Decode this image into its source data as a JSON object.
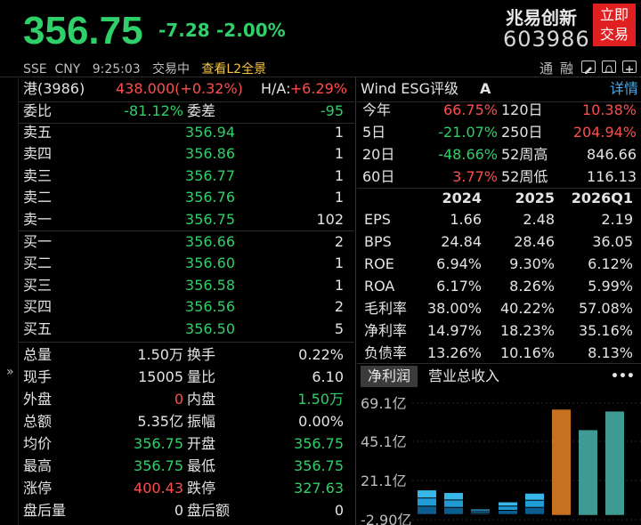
{
  "header": {
    "price": "356.75",
    "change": "-7.28",
    "change_pct": "-2.00%",
    "exchange": "SSE",
    "currency": "CNY",
    "time": "9:25:03",
    "status": "交易中",
    "l2_link": "查看L2全景",
    "stock_name": "兆易创新",
    "stock_code": "603986",
    "trade_button": [
      "立即",
      "交易"
    ],
    "tools": [
      "通",
      "融"
    ]
  },
  "hk_line": {
    "label": "港(3986)",
    "value": "438.000(+0.32%)",
    "ha_label": "H/A:",
    "ha_value": "+6.29%"
  },
  "order_ratio": {
    "ratio_label": "委比",
    "ratio_value": "-81.12%",
    "diff_label": "委差",
    "diff_value": "-95"
  },
  "asks": [
    {
      "label": "卖五",
      "price": "356.94",
      "vol": "1"
    },
    {
      "label": "卖四",
      "price": "356.86",
      "vol": "1"
    },
    {
      "label": "卖三",
      "price": "356.77",
      "vol": "1"
    },
    {
      "label": "卖二",
      "price": "356.76",
      "vol": "1"
    },
    {
      "label": "卖一",
      "price": "356.75",
      "vol": "102"
    }
  ],
  "bids": [
    {
      "label": "买一",
      "price": "356.66",
      "vol": "2"
    },
    {
      "label": "买二",
      "price": "356.60",
      "vol": "1"
    },
    {
      "label": "买三",
      "price": "356.58",
      "vol": "1"
    },
    {
      "label": "买四",
      "price": "356.56",
      "vol": "2"
    },
    {
      "label": "买五",
      "price": "356.50",
      "vol": "5"
    }
  ],
  "stats": [
    {
      "l1": "总量",
      "v1": "1.50万",
      "c1": "w",
      "l2": "换手",
      "v2": "0.22%",
      "c2": "w"
    },
    {
      "l1": "现手",
      "v1": "15005",
      "c1": "w",
      "l2": "量比",
      "v2": "6.10",
      "c2": "w"
    },
    {
      "l1": "外盘",
      "v1": "0",
      "c1": "r",
      "l2": "内盘",
      "v2": "1.50万",
      "c2": "g"
    },
    {
      "l1": "总额",
      "v1": "5.35亿",
      "c1": "w",
      "l2": "振幅",
      "v2": "0.00%",
      "c2": "w"
    },
    {
      "l1": "均价",
      "v1": "356.75",
      "c1": "g",
      "l2": "开盘",
      "v2": "356.75",
      "c2": "g"
    },
    {
      "l1": "最高",
      "v1": "356.75",
      "c1": "g",
      "l2": "最低",
      "v2": "356.75",
      "c2": "g"
    },
    {
      "l1": "涨停",
      "v1": "400.43",
      "c1": "r",
      "l2": "跌停",
      "v2": "327.63",
      "c2": "g"
    },
    {
      "l1": "盘后量",
      "v1": "0",
      "c1": "w",
      "l2": "盘后额",
      "v2": "0",
      "c2": "w"
    }
  ],
  "side_toggle": "»",
  "esg": {
    "title": "Wind ESG评级",
    "rating": "A",
    "detail_link": "详情"
  },
  "performance": [
    {
      "l1": "今年",
      "v1": "66.75%",
      "c1": "r",
      "l2": "120日",
      "v2": "10.38%",
      "c2": "r"
    },
    {
      "l1": "5日",
      "v1": "-21.07%",
      "c1": "g",
      "l2": "250日",
      "v2": "204.94%",
      "c2": "r"
    },
    {
      "l1": "20日",
      "v1": "-48.66%",
      "c1": "g",
      "l2": "52周高",
      "v2": "846.66",
      "c2": "w"
    },
    {
      "l1": "60日",
      "v1": "3.77%",
      "c1": "r",
      "l2": "52周低",
      "v2": "116.13",
      "c2": "w"
    }
  ],
  "financials": {
    "years": [
      "2024",
      "2025",
      "2026Q1"
    ],
    "rows": [
      {
        "label": "EPS",
        "values": [
          "1.66",
          "2.48",
          "2.19"
        ]
      },
      {
        "label": "BPS",
        "values": [
          "24.84",
          "28.46",
          "36.05"
        ]
      },
      {
        "label": "ROE",
        "values": [
          "6.94%",
          "9.30%",
          "6.12%"
        ]
      },
      {
        "label": "ROA",
        "values": [
          "6.17%",
          "8.26%",
          "5.99%"
        ]
      },
      {
        "label": "毛利率",
        "values": [
          "38.00%",
          "40.22%",
          "57.08%"
        ]
      },
      {
        "label": "净利率",
        "values": [
          "14.97%",
          "18.23%",
          "35.16%"
        ]
      },
      {
        "label": "负债率",
        "values": [
          "13.26%",
          "10.16%",
          "8.13%"
        ]
      }
    ]
  },
  "chart_tabs": [
    "净利润",
    "营业总收入"
  ],
  "more_label": "•••",
  "chart_data": {
    "type": "bar",
    "y_ticks": [
      "69.1亿",
      "45.1亿",
      "21.1亿",
      "-2.90亿"
    ],
    "ylim": [
      -2.9,
      69.1
    ],
    "bars": [
      {
        "value": 15.2,
        "color": "#1f9bd6",
        "stack": [
          5.2,
          5.0,
          5.0
        ]
      },
      {
        "value": 13.6,
        "color": "#1f9bd6",
        "stack": [
          4.4,
          4.6,
          4.6
        ]
      },
      {
        "value": 3.4,
        "color": "#1f9bd6",
        "stack": [
          1.1,
          1.1,
          1.2
        ]
      },
      {
        "value": 7.8,
        "color": "#1f9bd6",
        "stack": [
          2.6,
          2.6,
          2.6
        ]
      },
      {
        "value": 13.2,
        "color": "#1f9bd6",
        "stack": [
          4.4,
          4.4,
          4.4
        ]
      },
      {
        "value": 65.1,
        "color": "#c6711f",
        "stack": [
          65.1
        ]
      },
      {
        "value": 52.4,
        "color": "#3f9a93",
        "stack": [
          52.4
        ]
      },
      {
        "value": 63.9,
        "color": "#3f9a93",
        "stack": [
          63.9
        ]
      }
    ]
  }
}
